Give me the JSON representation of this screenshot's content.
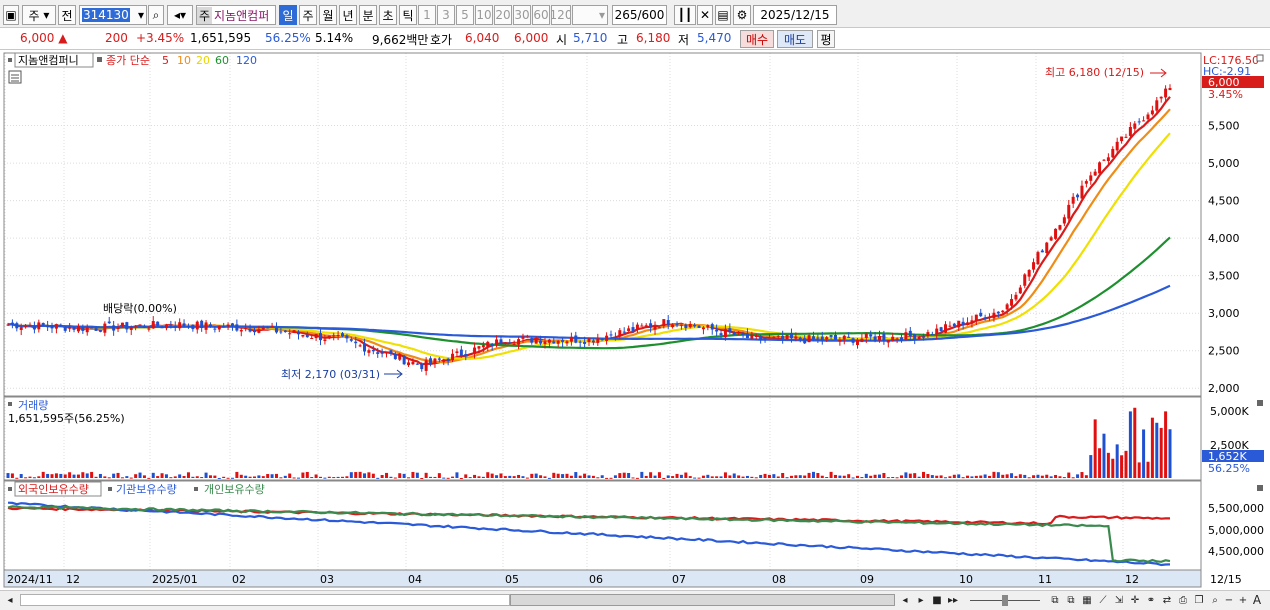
{
  "toolbar": {
    "type_label": "주",
    "prefix_label": "전",
    "code_value": "314130",
    "name_tag": "주",
    "stock_name": "지놈앤컴퍼",
    "periods": [
      "일",
      "주",
      "월",
      "년",
      "분",
      "초",
      "틱"
    ],
    "intervals": [
      "1",
      "3",
      "5",
      "10",
      "20",
      "30",
      "60",
      "120"
    ],
    "count_value": "265",
    "count_total": "/600",
    "date_value": "2025/12/15"
  },
  "quote": {
    "price": "6,000",
    "change": "200",
    "change_pct": "+3.45%",
    "volume": "1,651,595",
    "vol_ratio": "56.25%",
    "turnover": "5.14%",
    "amount": "9,662백만",
    "hoga_label": "호가",
    "ask": "6,040",
    "bid": "6,000",
    "open_label": "시",
    "open": "5,710",
    "high_label": "고",
    "high": "6,180",
    "low_label": "저",
    "low": "5,470",
    "buy_label": "매수",
    "sell_label": "매도",
    "flat_label": "평"
  },
  "price_panel": {
    "name_label": "지놈앤컴퍼니",
    "ma_label": "종가 단순",
    "ma_periods": [
      "5",
      "10",
      "20",
      "60",
      "120"
    ],
    "ma_colors": [
      "#d81b1b",
      "#ef8c16",
      "#f0e000",
      "#1e8f2e",
      "#2a5ad8"
    ],
    "lc": "LC:176.50",
    "hc": "HC:-2.91",
    "last_price": "6,000",
    "last_pct": "3.45%",
    "max_note": "최고 6,180 (12/15)",
    "min_note": "최저 2,170 (03/31)",
    "div_note": "배당락(0.00%)",
    "y_ticks": [
      "5,500",
      "5,000",
      "4,500",
      "4,000",
      "3,500",
      "3,000",
      "2,500",
      "2,000"
    ]
  },
  "volume_panel": {
    "title": "거래량",
    "value": "1,651,595주(56.25%)",
    "y_ticks": [
      "5,000K",
      "2,500K"
    ],
    "last": "1,652K",
    "last_pct": "56.25%"
  },
  "holding_panel": {
    "labels": [
      "외국인보유수량",
      "기관보유수량",
      "개인보유수량"
    ],
    "colors": [
      "#d81b1b",
      "#2a5ad8",
      "#3a8a4e"
    ],
    "y_ticks": [
      "5,500,000",
      "5,000,000",
      "4,500,000"
    ]
  },
  "x_axis": {
    "labels": [
      "2024/11",
      "12",
      "2025/01",
      "02",
      "03",
      "04",
      "05",
      "06",
      "07",
      "08",
      "09",
      "10",
      "11",
      "12"
    ],
    "right_label": "12/15"
  },
  "chart_data": {
    "type": "candlestick",
    "x": [
      "2024/11",
      "12",
      "2025/01",
      "02",
      "03",
      "04",
      "05",
      "06",
      "07",
      "08",
      "09",
      "10",
      "11",
      "12",
      "12/15"
    ],
    "close": [
      2850,
      2800,
      2850,
      2800,
      2650,
      2300,
      2650,
      2650,
      2900,
      2650,
      2650,
      2700,
      3050,
      4800,
      6000
    ],
    "ylim": [
      1950,
      6400
    ],
    "high_point": {
      "date": "12/15",
      "value": 6180
    },
    "low_point": {
      "date": "03/31",
      "value": 2170
    }
  }
}
